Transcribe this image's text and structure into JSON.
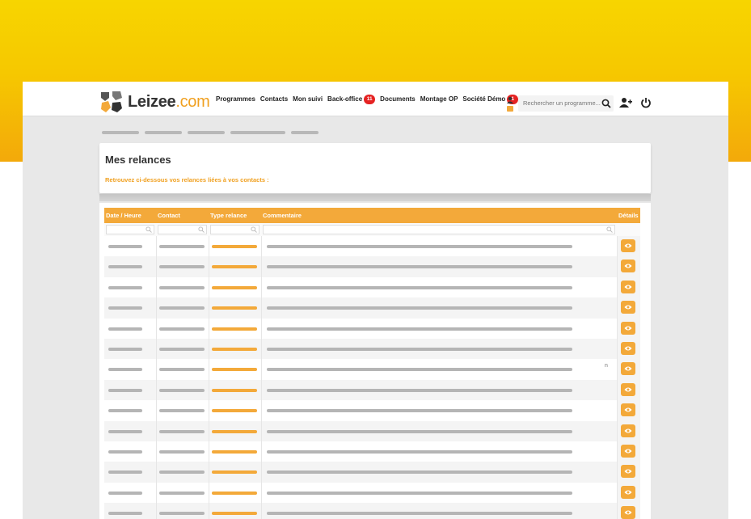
{
  "brand": {
    "name": "Leizee",
    "domain": ".com",
    "colors": {
      "accent": "#f3a93a",
      "badge": "#e52222",
      "text": "#333333"
    }
  },
  "nav": {
    "items": [
      {
        "label": "Programmes"
      },
      {
        "label": "Contacts"
      },
      {
        "label": "Mon suivi"
      },
      {
        "label": "Back-office",
        "badge": "11"
      },
      {
        "label": "Documents"
      },
      {
        "label": "Montage OP"
      },
      {
        "label": "Société Démo",
        "badge": "1"
      }
    ],
    "search_placeholder": "Rechercher un programme...",
    "icons": [
      "user-icon",
      "search-icon",
      "add-user-icon",
      "power-icon"
    ]
  },
  "page": {
    "title": "Mes relances",
    "subtitle": "Retrouvez ci-dessous vos relances liées à vos contacts :"
  },
  "table": {
    "columns": [
      "Date / Heure",
      "Contact",
      "Type relance",
      "Commentaire",
      "Détails"
    ],
    "stray_text": "n",
    "row_action_icon": "eye-icon"
  }
}
